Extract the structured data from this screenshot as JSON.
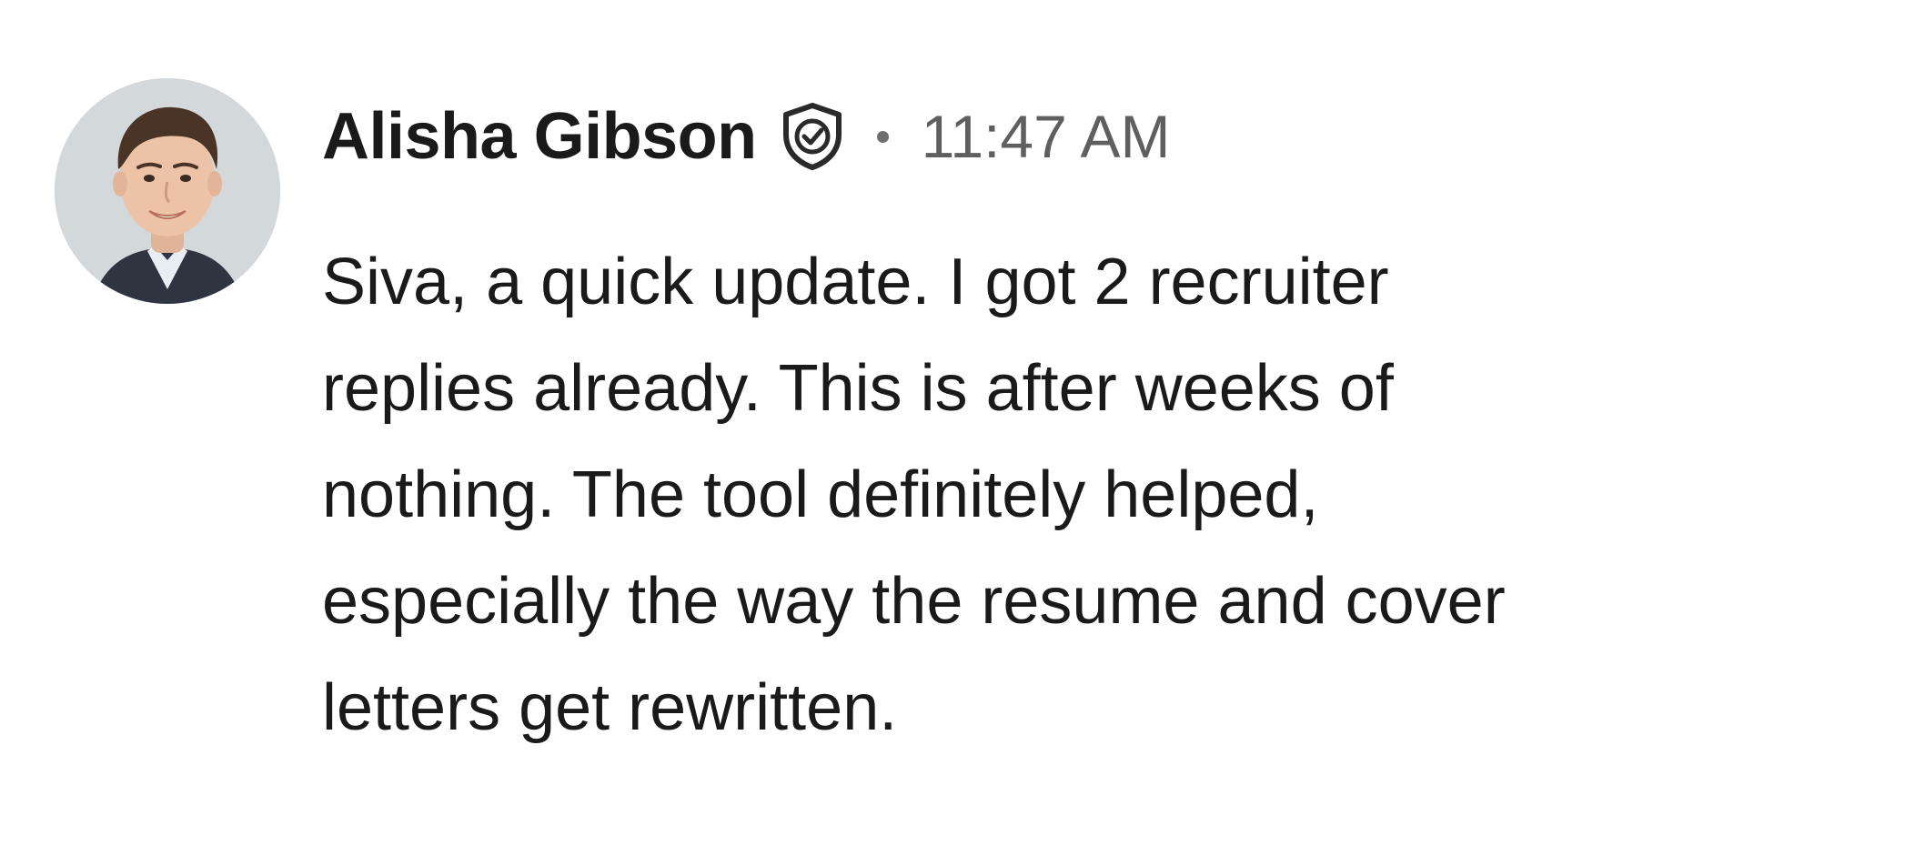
{
  "message": {
    "author": "Alisha Gibson",
    "timestamp": "11:47 AM",
    "body_lines": [
      "Siva, a quick update. I got 2 recruiter",
      "replies already. This is after weeks of",
      "nothing. The tool definitely helped,",
      "especially the way the resume and cover",
      "letters get rewritten."
    ],
    "icons": {
      "verified": "verified-shield-check-icon"
    }
  },
  "colors": {
    "text_primary": "#1a1a1a",
    "text_secondary": "#5f5f5f",
    "background": "#ffffff"
  }
}
